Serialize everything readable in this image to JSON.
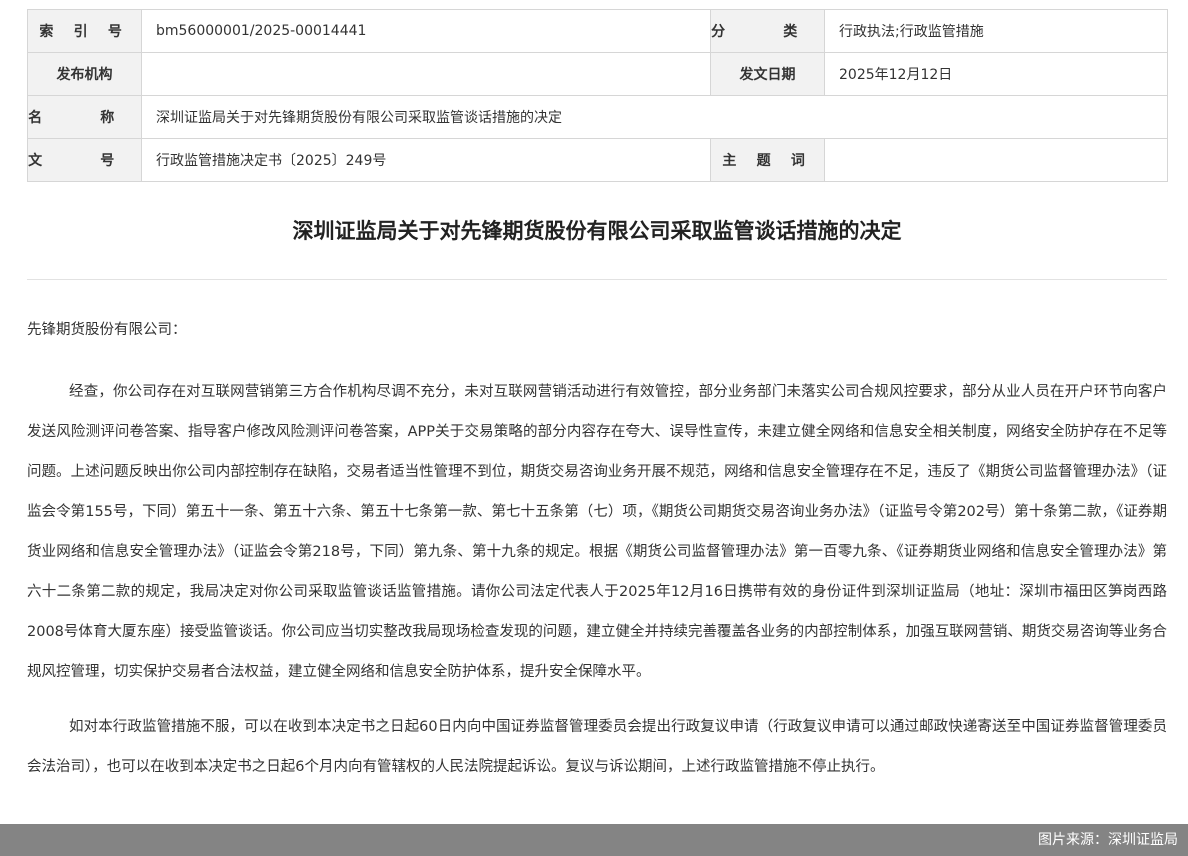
{
  "meta": {
    "index_label": "索 引 号",
    "index_value": "bm56000001/2025-00014441",
    "category_label": "分 类",
    "category_value": "行政执法;行政监管措施",
    "issuer_label": "发布机构",
    "issuer_value": "",
    "date_label": "发文日期",
    "date_value": "2025年12月12日",
    "name_label": "名 称",
    "name_value": "深圳证监局关于对先锋期货股份有限公司采取监管谈话措施的决定",
    "docno_label": "文 号",
    "docno_value": "行政监管措施决定书〔2025〕249号",
    "keywords_label": "主 题 词",
    "keywords_value": ""
  },
  "document": {
    "title": "深圳证监局关于对先锋期货股份有限公司采取监管谈话措施的决定",
    "salutation": "先锋期货股份有限公司：",
    "paragraphs": [
      "经查，你公司存在对互联网营销第三方合作机构尽调不充分，未对互联网营销活动进行有效管控，部分业务部门未落实公司合规风控要求，部分从业人员在开户环节向客户发送风险测评问卷答案、指导客户修改风险测评问卷答案，APP关于交易策略的部分内容存在夸大、误导性宣传，未建立健全网络和信息安全相关制度，网络安全防护存在不足等问题。上述问题反映出你公司内部控制存在缺陷，交易者适当性管理不到位，期货交易咨询业务开展不规范，网络和信息安全管理存在不足，违反了《期货公司监督管理办法》（证监会令第155号，下同）第五十一条、第五十六条、第五十七条第一款、第七十五条第（七）项，《期货公司期货交易咨询业务办法》（证监号令第202号）第十条第二款，《证券期货业网络和信息安全管理办法》（证监会令第218号，下同）第九条、第十九条的规定。根据《期货公司监督管理办法》第一百零九条、《证券期货业网络和信息安全管理办法》第六十二条第二款的规定，我局决定对你公司采取监管谈话监管措施。请你公司法定代表人于2025年12月16日携带有效的身份证件到深圳证监局（地址：深圳市福田区笋岗西路2008号体育大厦东座）接受监管谈话。你公司应当切实整改我局现场检查发现的问题，建立健全并持续完善覆盖各业务的内部控制体系，加强互联网营销、期货交易咨询等业务合规风控管理，切实保护交易者合法权益，建立健全网络和信息安全防护体系，提升安全保障水平。",
      "如对本行政监管措施不服，可以在收到本决定书之日起60日内向中国证券监督管理委员会提出行政复议申请（行政复议申请可以通过邮政快递寄送至中国证券监督管理委员会法治司），也可以在收到本决定书之日起6个月内向有管辖权的人民法院提起诉讼。复议与诉讼期间，上述行政监管措施不停止执行。"
    ]
  },
  "source_credit": "图片来源：深圳证监局"
}
